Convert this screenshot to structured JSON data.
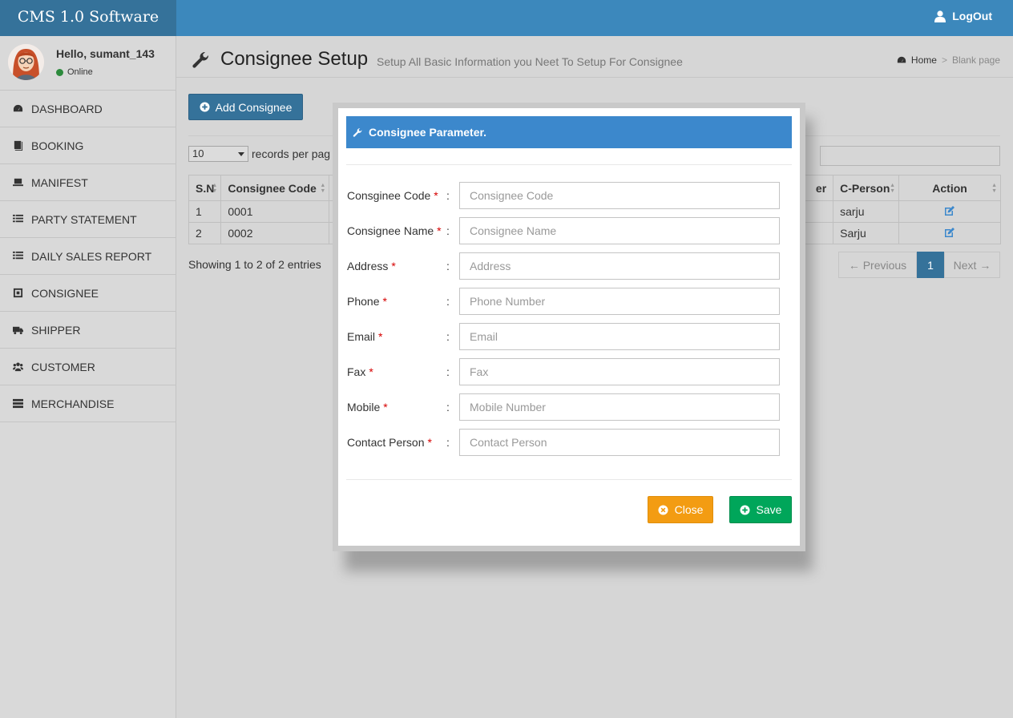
{
  "app": {
    "logo": "CMS 1.0 Software"
  },
  "header": {
    "logout_label": "LogOut"
  },
  "user": {
    "greeting": "Hello, sumant_143",
    "status": "Online"
  },
  "sidebar": {
    "items": [
      {
        "label": "DASHBOARD",
        "icon": "dashboard-icon"
      },
      {
        "label": "BOOKING",
        "icon": "book-icon"
      },
      {
        "label": "MANIFEST",
        "icon": "laptop-icon"
      },
      {
        "label": "PARTY STATEMENT",
        "icon": "list-icon"
      },
      {
        "label": "DAILY SALES REPORT",
        "icon": "list-icon"
      },
      {
        "label": "CONSIGNEE",
        "icon": "square-icon"
      },
      {
        "label": "SHIPPER",
        "icon": "truck-icon"
      },
      {
        "label": "CUSTOMER",
        "icon": "users-icon"
      },
      {
        "label": "MERCHANDISE",
        "icon": "server-icon"
      }
    ]
  },
  "page": {
    "title": "Consignee Setup",
    "subtitle": "Setup All Basic Information you Neet To Setup For Consignee",
    "breadcrumb": {
      "home": "Home",
      "separator": ">",
      "current": "Blank page"
    }
  },
  "toolbar": {
    "add_label": "Add Consignee"
  },
  "table": {
    "length_value": "10",
    "length_label": "records per pag",
    "columns": {
      "sn": "S.N",
      "code": "Consignee Code",
      "hidden_tail": "er",
      "person": "C-Person",
      "action": "Action"
    },
    "rows": [
      {
        "sn": "1",
        "code": "0001",
        "person": "sarju"
      },
      {
        "sn": "2",
        "code": "0002",
        "person": "Sarju"
      }
    ],
    "info": "Showing 1 to 2 of 2 entries",
    "pagination": {
      "prev": "← Previous",
      "page": "1",
      "next": "Next →"
    }
  },
  "modal": {
    "title": "Consignee Parameter.",
    "fields": [
      {
        "label": "Consginee Code",
        "placeholder": "Consignee Code"
      },
      {
        "label": "Consignee Name",
        "placeholder": "Consignee Name"
      },
      {
        "label": "Address",
        "placeholder": "Address"
      },
      {
        "label": "Phone",
        "placeholder": "Phone Number"
      },
      {
        "label": "Email",
        "placeholder": "Email"
      },
      {
        "label": "Fax",
        "placeholder": "Fax"
      },
      {
        "label": "Mobile",
        "placeholder": "Mobile Number"
      },
      {
        "label": "Contact Person",
        "placeholder": "Contact Person"
      }
    ],
    "required_mark": "*",
    "colon": ":",
    "close_label": "Close",
    "save_label": "Save"
  },
  "colors": {
    "primary": "#3c88bc",
    "logo_bg": "#35729a",
    "modal_header": "#3c88cc",
    "warning": "#f39c12",
    "success": "#00a65a",
    "required": "#d60000"
  }
}
